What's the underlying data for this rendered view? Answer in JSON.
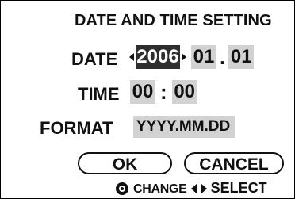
{
  "title": "DATE AND TIME SETTING",
  "date": {
    "label": "DATE",
    "year": "2006",
    "dot1": ".",
    "month": "01",
    "dot2": ".",
    "day": "01"
  },
  "time": {
    "label": "TIME",
    "hour": "00",
    "colon": ":",
    "minute": "00"
  },
  "format": {
    "label": "FORMAT",
    "value": "YYYY.MM.DD"
  },
  "buttons": {
    "ok": "OK",
    "cancel": "CANCEL"
  },
  "hint": {
    "change": "CHANGE",
    "select": "SELECT"
  },
  "colors": {
    "field_bg": "#d2d2d2",
    "selected_bg": "#2e2e2e",
    "selected_text": "#ffffff"
  },
  "icons": {
    "dial": "control-dial-icon",
    "left_right": "left-right-arrows-icon"
  }
}
